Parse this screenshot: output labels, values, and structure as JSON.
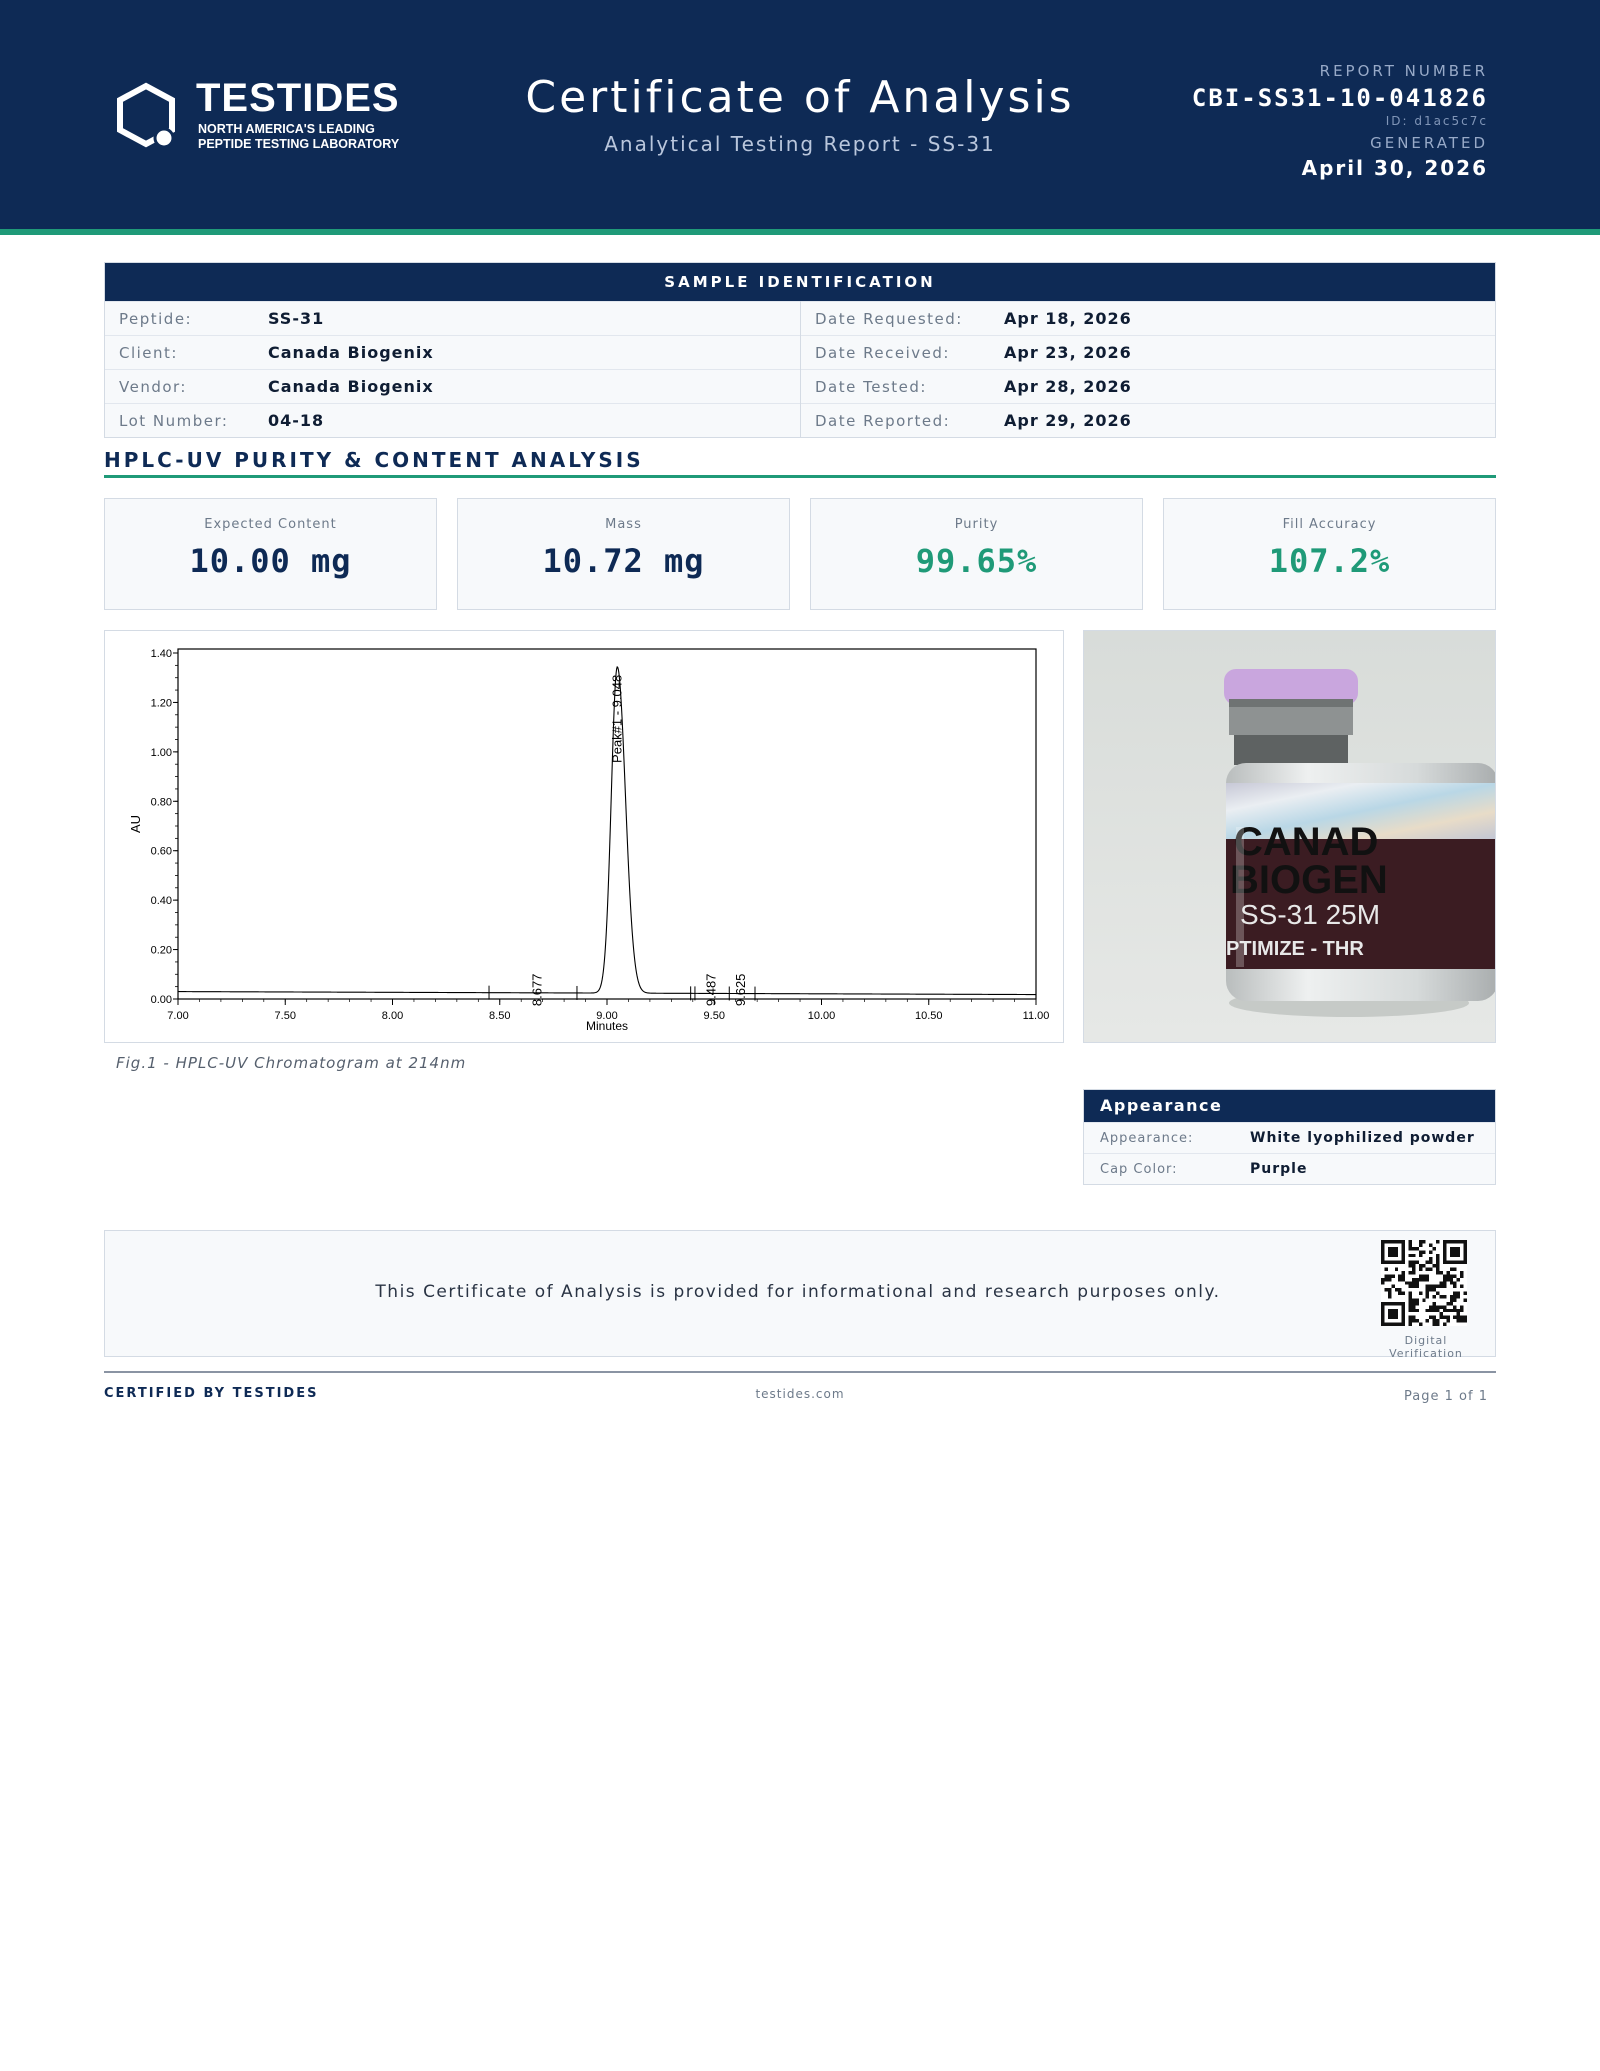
{
  "header": {
    "brand": "TESTIDES",
    "brand_sub_1": "NORTH AMERICA'S LEADING",
    "brand_sub_2": "PEPTIDE TESTING LABORATORY",
    "title": "Certificate of Analysis",
    "subtitle": "Analytical Testing Report - SS-31",
    "report_number_label": "REPORT NUMBER",
    "report_number": "CBI-SS31-10-041826",
    "report_id": "ID: d1ac5c7c",
    "generated_label": "GENERATED",
    "generated_date": "April 30, 2026"
  },
  "sample_identification": {
    "heading": "SAMPLE IDENTIFICATION",
    "left": [
      {
        "label": "Peptide:",
        "value": "SS-31"
      },
      {
        "label": "Client:",
        "value": "Canada Biogenix"
      },
      {
        "label": "Vendor:",
        "value": "Canada Biogenix"
      },
      {
        "label": "Lot Number:",
        "value": "04-18"
      }
    ],
    "right": [
      {
        "label": "Date Requested:",
        "value": "Apr 18, 2026"
      },
      {
        "label": "Date Received:",
        "value": "Apr 23, 2026"
      },
      {
        "label": "Date Tested:",
        "value": "Apr 28, 2026"
      },
      {
        "label": "Date Reported:",
        "value": "Apr 29, 2026"
      }
    ]
  },
  "analysis": {
    "heading": "HPLC-UV PURITY & CONTENT ANALYSIS",
    "metrics": [
      {
        "label": "Expected Content",
        "value": "10.00 mg"
      },
      {
        "label": "Mass",
        "value": "10.72 mg"
      },
      {
        "label": "Purity",
        "value": "99.65%"
      },
      {
        "label": "Fill Accuracy",
        "value": "107.2%"
      }
    ],
    "figure_caption": "Fig.1 - HPLC-UV Chromatogram at 214nm"
  },
  "chart_data": {
    "type": "line",
    "xlabel": "Minutes",
    "ylabel": "AU",
    "xlim": [
      7.0,
      11.0
    ],
    "ylim": [
      0.0,
      1.4
    ],
    "x_ticks": [
      "7.00",
      "7.50",
      "8.00",
      "8.50",
      "9.00",
      "9.50",
      "10.00",
      "10.50",
      "11.00"
    ],
    "y_ticks": [
      "0.00",
      "0.20",
      "0.40",
      "0.60",
      "0.80",
      "1.00",
      "1.20",
      "1.40"
    ],
    "baseline": 0.03,
    "peaks": [
      {
        "label": "8.677",
        "x": 8.677,
        "height": 0.0
      },
      {
        "label": "Peak#1 - 9.048",
        "x": 9.048,
        "height": 1.32
      },
      {
        "label": "9.487",
        "x": 9.487,
        "height": 0.0
      },
      {
        "label": "9.625",
        "x": 9.625,
        "height": 0.0
      }
    ]
  },
  "photo": {
    "label_line1": "CANAD",
    "label_line2": "BIOGEN",
    "label_line3": "SS-31 25M",
    "label_line4": "PTIMIZE - THR"
  },
  "appearance": {
    "heading": "Appearance",
    "rows": [
      {
        "label": "Appearance:",
        "value": "White lyophilized powder"
      },
      {
        "label": "Cap Color:",
        "value": "Purple"
      }
    ]
  },
  "disclaimer": {
    "text": "This Certificate of Analysis is provided for informational and research purposes only.",
    "qr_label": "Digital Verification"
  },
  "footer": {
    "left": "CERTIFIED BY TESTIDES",
    "middle": "testides.com",
    "right": "Page 1 of 1"
  },
  "colors": {
    "navy": "#0e2a55",
    "green": "#1f9a78",
    "cap": "#c9a6de"
  }
}
